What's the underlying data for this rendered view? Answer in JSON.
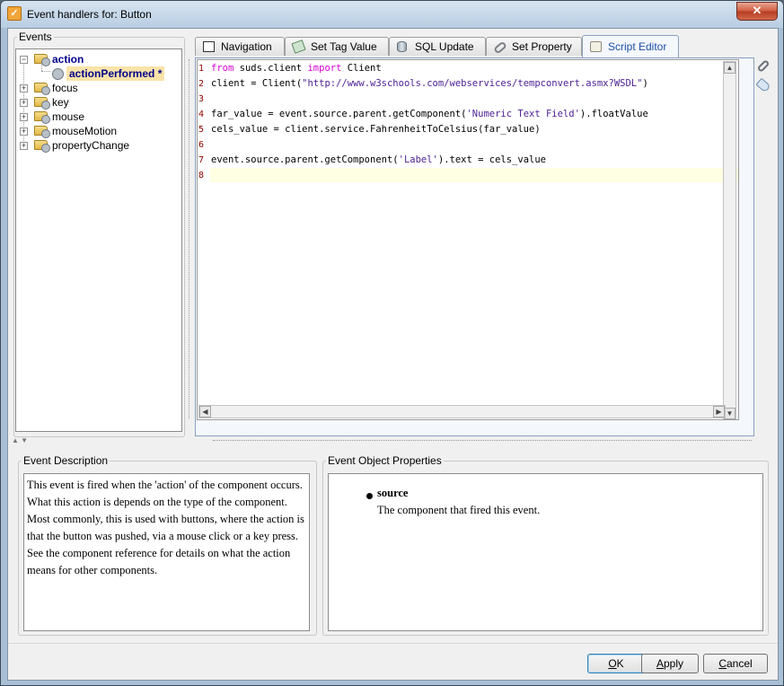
{
  "window": {
    "title": "Event handlers for: Button",
    "close_glyph": "✕"
  },
  "events_panel": {
    "title": "Events",
    "tree": [
      {
        "label": "action",
        "expanded": true,
        "children": [
          {
            "label": "actionPerformed *",
            "selected": true
          }
        ]
      },
      {
        "label": "focus",
        "expanded": false
      },
      {
        "label": "key",
        "expanded": false
      },
      {
        "label": "mouse",
        "expanded": false
      },
      {
        "label": "mouseMotion",
        "expanded": false
      },
      {
        "label": "propertyChange",
        "expanded": false
      }
    ]
  },
  "tabs": [
    {
      "label": "Navigation",
      "icon": "window-icon",
      "active": false
    },
    {
      "label": "Set Tag Value",
      "icon": "tag-check-icon",
      "active": false
    },
    {
      "label": "SQL Update",
      "icon": "database-icon",
      "active": false
    },
    {
      "label": "Set Property",
      "icon": "link-icon",
      "active": false
    },
    {
      "label": "Script Editor",
      "icon": "scroll-icon",
      "active": true
    }
  ],
  "script": {
    "line_numbers": [
      "1",
      "2",
      "3",
      "4",
      "5",
      "6",
      "7",
      "8"
    ],
    "lines": [
      [
        {
          "t": "from",
          "c": "kw"
        },
        {
          "t": " suds.client ",
          "c": ""
        },
        {
          "t": "import",
          "c": "kw"
        },
        {
          "t": " Client",
          "c": ""
        }
      ],
      [
        {
          "t": "client = Client(",
          "c": ""
        },
        {
          "t": "\"http://www.w3schools.com/webservices/tempconvert.asmx?WSDL\"",
          "c": "str"
        },
        {
          "t": ")",
          "c": ""
        }
      ],
      [],
      [
        {
          "t": "far_value = event.source.parent.getComponent(",
          "c": ""
        },
        {
          "t": "'Numeric Text Field'",
          "c": "str"
        },
        {
          "t": ").floatValue",
          "c": ""
        }
      ],
      [
        {
          "t": "cels_value = client.service.FahrenheitToCelsius(far_value)",
          "c": ""
        }
      ],
      [],
      [
        {
          "t": "event.source.parent.getComponent(",
          "c": ""
        },
        {
          "t": "'Label'",
          "c": "str"
        },
        {
          "t": ").text = cels_value",
          "c": ""
        }
      ],
      []
    ],
    "current_line": 8
  },
  "side_tools": [
    "link-icon",
    "tag-icon"
  ],
  "event_description": {
    "title": "Event Description",
    "text": "This event is fired when the 'action' of the component occurs. What this action is depends on the type of the component. Most commonly, this is used with buttons, where the action is that the button was pushed, via a mouse click or a key press. See the component reference for details on what the action means for other components."
  },
  "event_properties": {
    "title": "Event Object Properties",
    "items": [
      {
        "name": "source",
        "description": "The component that fired this event."
      }
    ]
  },
  "buttons": {
    "ok": {
      "mnemonic": "O",
      "rest": "K"
    },
    "apply": {
      "mnemonic": "A",
      "rest": "pply"
    },
    "cancel": {
      "mnemonic": "C",
      "rest": "ancel"
    }
  }
}
